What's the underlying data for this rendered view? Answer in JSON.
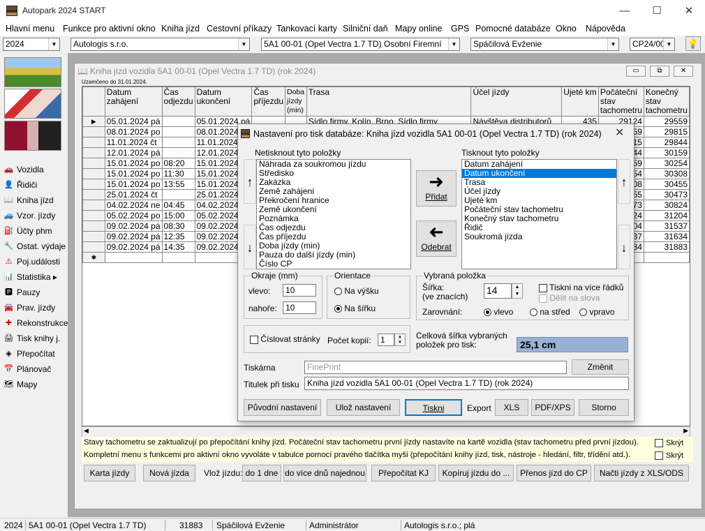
{
  "window": {
    "title": "Autopark 2024 START",
    "min": "—",
    "max": "☐",
    "close": "✕"
  },
  "menu": [
    "Hlavní menu",
    "Funkce pro aktivní okno",
    "Kniha jízd",
    "Cestovní příkazy",
    "Tankovací karty",
    "Silniční daň",
    "Mapy online",
    "GPS",
    "Pomocné databáze",
    "Okno",
    "Nápověda"
  ],
  "toolbar": {
    "year": "2024",
    "company": "Autologis s.r.o.",
    "vehicle": "5A1 00-01 (Opel Vectra 1.7 TD) Osobní Firemní",
    "driver": "Spáčilová Evženie",
    "code": "CP24/00"
  },
  "sidebar": [
    "Vozidla",
    "Řidiči",
    "Kniha jízd",
    "Vzor. jízdy",
    "Účty phm",
    "Ostat. výdaje",
    "Poj.události",
    "Statistika ▸",
    "Pauzy",
    "Prav. jízdy",
    "Rekonstrukce",
    "Tisk knihy j.",
    "Přepočítat",
    "Plánovač",
    "Mapy"
  ],
  "logbook": {
    "title": "Kniha jízd vozidla  5A1 00-01 (Opel Vectra 1.7 TD) (rok 2024)",
    "note": "Uzamčeno do 31.01.2024.",
    "columns": [
      "Datum zahájení",
      "Čas odjezdu",
      "Datum ukončení",
      "Čas příjezdu",
      "Doba jízdy (min)",
      "Trasa",
      "Účel jízdy",
      "Ujeté km",
      "Počáteční stav tachometru",
      "Konečný stav tachometru"
    ],
    "rows": [
      {
        "start": "05.01.2024 pá",
        "dep": "",
        "end": "05.01.2024 pá",
        "arr": "",
        "route": "Sídlo firmy, Kolín, Brno, Sídlo firmy",
        "purpose": "Návštěva distributorů",
        "km": "435",
        "t0": "29124",
        "t1": "29559"
      },
      {
        "start": "08.01.2024 po",
        "dep": "",
        "end": "08.01.2024 po",
        "arr": "",
        "route": "",
        "purpose": "",
        "km": "",
        "t0": "559",
        "t1": "29815"
      },
      {
        "start": "11.01.2024 čt",
        "dep": "",
        "end": "11.01.2024 čt",
        "arr": "",
        "route": "",
        "purpose": "",
        "km": "",
        "t0": "815",
        "t1": "29844"
      },
      {
        "start": "12.01.2024 pá",
        "dep": "",
        "end": "12.01.2024 pá",
        "arr": "",
        "route": "",
        "purpose": "",
        "km": "",
        "t0": "844",
        "t1": "30159"
      },
      {
        "start": "15.01.2024 po",
        "dep": "08:20",
        "end": "15.01.2024 po",
        "arr": "",
        "route": "",
        "purpose": "",
        "km": "",
        "t0": "159",
        "t1": "30254"
      },
      {
        "start": "15.01.2024 po",
        "dep": "11:30",
        "end": "15.01.2024 po",
        "arr": "",
        "route": "",
        "purpose": "",
        "km": "",
        "t0": "254",
        "t1": "30308"
      },
      {
        "start": "15.01.2024 po",
        "dep": "13:55",
        "end": "15.01.2024 po",
        "arr": "",
        "route": "",
        "purpose": "",
        "km": "",
        "t0": "308",
        "t1": "30455"
      },
      {
        "start": "25.01.2024 čt",
        "dep": "",
        "end": "25.01.2024 čt",
        "arr": "",
        "route": "",
        "purpose": "",
        "km": "",
        "t0": "455",
        "t1": "30473"
      },
      {
        "start": "04.02.2024 ne",
        "dep": "04:45",
        "end": "04.02.2024 ne",
        "arr": "",
        "route": "",
        "purpose": "",
        "km": "",
        "t0": "473",
        "t1": "30824"
      },
      {
        "start": "05.02.2024 po",
        "dep": "15:00",
        "end": "05.02.2024 po",
        "arr": "",
        "route": "",
        "purpose": "",
        "km": "",
        "t0": "824",
        "t1": "31204"
      },
      {
        "start": "09.02.2024 pá",
        "dep": "08:30",
        "end": "09.02.2024 pá",
        "arr": "",
        "route": "",
        "purpose": "",
        "km": "",
        "t0": "204",
        "t1": "31537"
      },
      {
        "start": "09.02.2024 pá",
        "dep": "12:35",
        "end": "09.02.2024 pá",
        "arr": "",
        "route": "",
        "purpose": "",
        "km": "",
        "t0": "537",
        "t1": "31634"
      },
      {
        "start": "09.02.2024 pá",
        "dep": "14:35",
        "end": "09.02.2024 pá",
        "arr": "",
        "route": "",
        "purpose": "",
        "km": "",
        "t0": "634",
        "t1": "31883"
      }
    ],
    "new_row_marker": "✱",
    "current_row_marker": "▶",
    "info1": "Stavy tachometru se zaktualizují po přepočítání knihy jízd. Počáteční stav tachometru první jízdy nastavíte na kartě vozidla (stav tachometru před první jízdou).",
    "info2": "Kompletní menu s funkcemi pro aktivní okno vyvoláte v tabulce pomocí pravého tlačítka myši (přepočítání knihy jízd, tisk, nástroje - hledání, filtr, třídění atd.).",
    "skryt": "Skrýt",
    "buttons": {
      "karta": "Karta jízdy",
      "nova": "Nová jízda",
      "vloz_label": "Vlož jízdu:",
      "do1": "do 1 dne",
      "dovice": "do více dnů najednou",
      "prepocitat": "Přepočítat KJ",
      "kopiruj": "Kopíruj jízdu do ...",
      "prenos": "Přenos jízd do CP",
      "nacti": "Načti jízdy z XLS/ODS"
    }
  },
  "dialog": {
    "title": "Nastavení pro tisk databáze: Kniha jízd vozidla  5A1 00-01 (Opel Vectra 1.7 TD) (rok 2024)",
    "left_label": "Netisknout tyto položky",
    "left_items": [
      "Náhrada za soukromou jízdu",
      "Středisko",
      "Zakázka",
      "Země zahájení",
      "Překročení hranice",
      "Země ukončení",
      "Poznámka",
      "Čas odjezdu",
      "Čas příjezdu",
      "Doba jízdy (min)",
      "Pauza do další jízdy (min)",
      "Číslo CP"
    ],
    "right_label": "Tisknout tyto položky",
    "right_items": [
      "Datum zahájení",
      "Datum ukončení",
      "Trasa",
      "Účel jízdy",
      "Ujeté km",
      "Počáteční stav tachometru",
      "Konečný stav tachometru",
      "Řidič",
      "Soukromá jízda"
    ],
    "right_selected": 1,
    "add": "Přidat",
    "remove": "Odebrat",
    "margins": {
      "title": "Okraje (mm)",
      "left_label": "vlevo:",
      "left": "10",
      "top_label": "nahoře:",
      "top": "10"
    },
    "orientation": {
      "title": "Orientace",
      "portrait": "Na výšku",
      "landscape": "Na šířku",
      "selected": "landscape"
    },
    "selected_item": {
      "title": "Vybraná položka",
      "width_label": "Šířka:",
      "width_sub": "(ve znacích)",
      "width": "14",
      "multiline": "Tiskni na více řádků",
      "split": "Dělit na slova",
      "align_label": "Zarovnání:",
      "left": "vlevo",
      "center": "na střed",
      "right": "vpravo",
      "align": "left"
    },
    "number_pages": "Číslovat stránky",
    "copies_label": "Počet kopií:",
    "copies": "1",
    "total_width_label": "Celková šířka vybraných položek pro tisk:",
    "total_width": "25,1 cm",
    "printer_label": "Tiskárna",
    "printer": "FinePrint",
    "change": "Změnit",
    "heading_label": "Titulek při tisku",
    "heading": "Kniha jízd vozidla  5A1 00-01 (Opel Vectra 1.7 TD) (rok 2024)",
    "buttons": {
      "original": "Původní nastavení",
      "save": "Ulož nastavení",
      "print": "Tiskni",
      "export": "Export",
      "xls": "XLS",
      "pdf": "PDF/XPS",
      "cancel": "Storno"
    }
  },
  "status": {
    "year": "2024",
    "vehicle": "5A1 00-01 (Opel Vectra 1.7 TD)",
    "km": "31883",
    "driver": "Spáčilová Evženie",
    "user": "Administrátor",
    "company": "Autologis s.r.o.;  plá"
  },
  "colors": {
    "accent": "#0078d7",
    "info_bg": "#ffffe0",
    "total_bg": "#97b2d4"
  }
}
